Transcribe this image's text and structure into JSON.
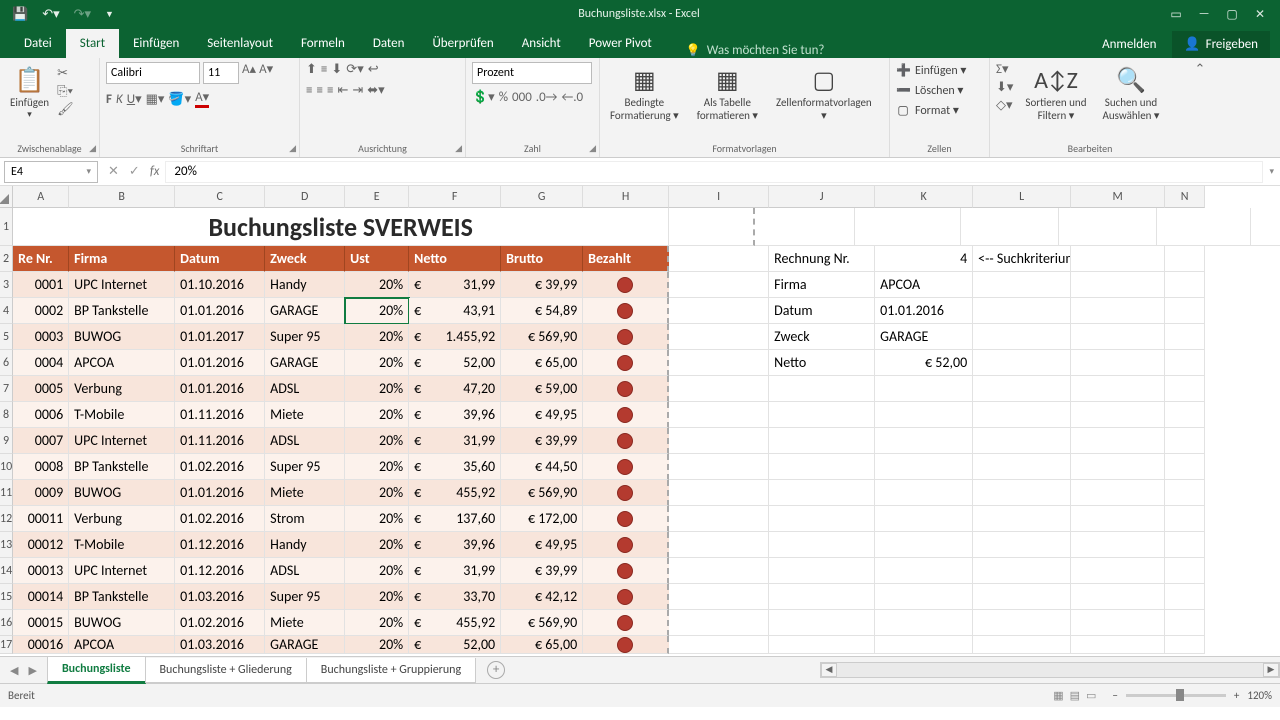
{
  "app": {
    "title": "Buchungsliste.xlsx - Excel"
  },
  "tabs": {
    "datei": "Datei",
    "start": "Start",
    "einfuegen": "Einfügen",
    "seitenlayout": "Seitenlayout",
    "formeln": "Formeln",
    "daten": "Daten",
    "ueberpruefen": "Überprüfen",
    "ansicht": "Ansicht",
    "powerpivot": "Power Pivot",
    "tellme": "Was möchten Sie tun?",
    "anmelden": "Anmelden",
    "freigeben": "Freigeben"
  },
  "ribbon": {
    "einfuegen": "Einfügen",
    "zwischen": "Zwischenablage",
    "schriftart": "Schriftart",
    "ausrichtung": "Ausrichtung",
    "zahl": "Zahl",
    "formatvorlagen": "Formatvorlagen",
    "zellen": "Zellen",
    "bearbeiten": "Bearbeiten",
    "fontname": "Calibri",
    "fontsize": "11",
    "numfmt": "Prozent",
    "bedingte": "Bedingte",
    "formatierung": "Formatierung ▾",
    "alstabelle": "Als Tabelle",
    "formatieren": "formatieren ▾",
    "zellenformat": "Zellenformatvorlagen",
    "zfv2": "▾",
    "ins": "Einfügen ▾",
    "del": "Löschen ▾",
    "fmt": "Format ▾",
    "sort": "Sortieren und",
    "filtern": "Filtern ▾",
    "suchen": "Suchen und",
    "auswaehlen": "Auswählen ▾"
  },
  "fx": {
    "name": "E4",
    "formula": "20%"
  },
  "cols": [
    "A",
    "B",
    "C",
    "D",
    "E",
    "F",
    "G",
    "H",
    "I",
    "J",
    "K",
    "L",
    "M",
    "N"
  ],
  "title_cell": "Buchungsliste SVERWEIS",
  "headers": {
    "a": "Re Nr.",
    "b": "Firma",
    "c": "Datum",
    "d": "Zweck",
    "e": "Ust",
    "f": "Netto",
    "g": "Brutto",
    "h": "Bezahlt"
  },
  "side": {
    "rechnung": "Rechnung Nr.",
    "rechnung_val": "4",
    "such": "<-- Suchkriterium",
    "firma": "Firma",
    "firma_val": "APCOA",
    "datum": "Datum",
    "datum_val": "01.01.2016",
    "zweck": "Zweck",
    "zweck_val": "GARAGE",
    "netto": "Netto",
    "netto_val": "€ 52,00"
  },
  "rows": [
    {
      "n": "0001",
      "f": "UPC Internet",
      "d": "01.10.2016",
      "z": "Handy",
      "u": "20%",
      "cur": "€",
      "ne": "31,99",
      "br": "€ 39,99"
    },
    {
      "n": "0002",
      "f": "BP Tankstelle",
      "d": "01.01.2016",
      "z": "GARAGE",
      "u": "20%",
      "cur": "€",
      "ne": "43,91",
      "br": "€ 54,89"
    },
    {
      "n": "0003",
      "f": "BUWOG",
      "d": "01.01.2017",
      "z": "Super 95",
      "u": "20%",
      "cur": "€",
      "ne": "1.455,92",
      "br": "€ 569,90"
    },
    {
      "n": "0004",
      "f": "APCOA",
      "d": "01.01.2016",
      "z": "GARAGE",
      "u": "20%",
      "cur": "€",
      "ne": "52,00",
      "br": "€ 65,00"
    },
    {
      "n": "0005",
      "f": "Verbung",
      "d": "01.01.2016",
      "z": "ADSL",
      "u": "20%",
      "cur": "€",
      "ne": "47,20",
      "br": "€ 59,00"
    },
    {
      "n": "0006",
      "f": "T-Mobile",
      "d": "01.11.2016",
      "z": "Miete",
      "u": "20%",
      "cur": "€",
      "ne": "39,96",
      "br": "€ 49,95"
    },
    {
      "n": "0007",
      "f": "UPC Internet",
      "d": "01.11.2016",
      "z": "ADSL",
      "u": "20%",
      "cur": "€",
      "ne": "31,99",
      "br": "€ 39,99"
    },
    {
      "n": "0008",
      "f": "BP Tankstelle",
      "d": "01.02.2016",
      "z": "Super 95",
      "u": "20%",
      "cur": "€",
      "ne": "35,60",
      "br": "€ 44,50"
    },
    {
      "n": "0009",
      "f": "BUWOG",
      "d": "01.01.2016",
      "z": "Miete",
      "u": "20%",
      "cur": "€",
      "ne": "455,92",
      "br": "€ 569,90"
    },
    {
      "n": "00011",
      "f": "Verbung",
      "d": "01.02.2016",
      "z": "Strom",
      "u": "20%",
      "cur": "€",
      "ne": "137,60",
      "br": "€ 172,00"
    },
    {
      "n": "00012",
      "f": "T-Mobile",
      "d": "01.12.2016",
      "z": "Handy",
      "u": "20%",
      "cur": "€",
      "ne": "39,96",
      "br": "€ 49,95"
    },
    {
      "n": "00013",
      "f": "UPC Internet",
      "d": "01.12.2016",
      "z": "ADSL",
      "u": "20%",
      "cur": "€",
      "ne": "31,99",
      "br": "€ 39,99"
    },
    {
      "n": "00014",
      "f": "BP Tankstelle",
      "d": "01.03.2016",
      "z": "Super 95",
      "u": "20%",
      "cur": "€",
      "ne": "33,70",
      "br": "€ 42,12"
    },
    {
      "n": "00015",
      "f": "BUWOG",
      "d": "01.02.2016",
      "z": "Miete",
      "u": "20%",
      "cur": "€",
      "ne": "455,92",
      "br": "€ 569,90"
    },
    {
      "n": "00016",
      "f": "APCOA",
      "d": "01.03.2016",
      "z": "GARAGE",
      "u": "20%",
      "cur": "€",
      "ne": "52,00",
      "br": "€ 65,00"
    }
  ],
  "sheets": {
    "s1": "Buchungsliste",
    "s2": "Buchungsliste + Gliederung",
    "s3": "Buchungsliste + Gruppierung"
  },
  "status": {
    "ready": "Bereit",
    "zoom": "120%"
  }
}
